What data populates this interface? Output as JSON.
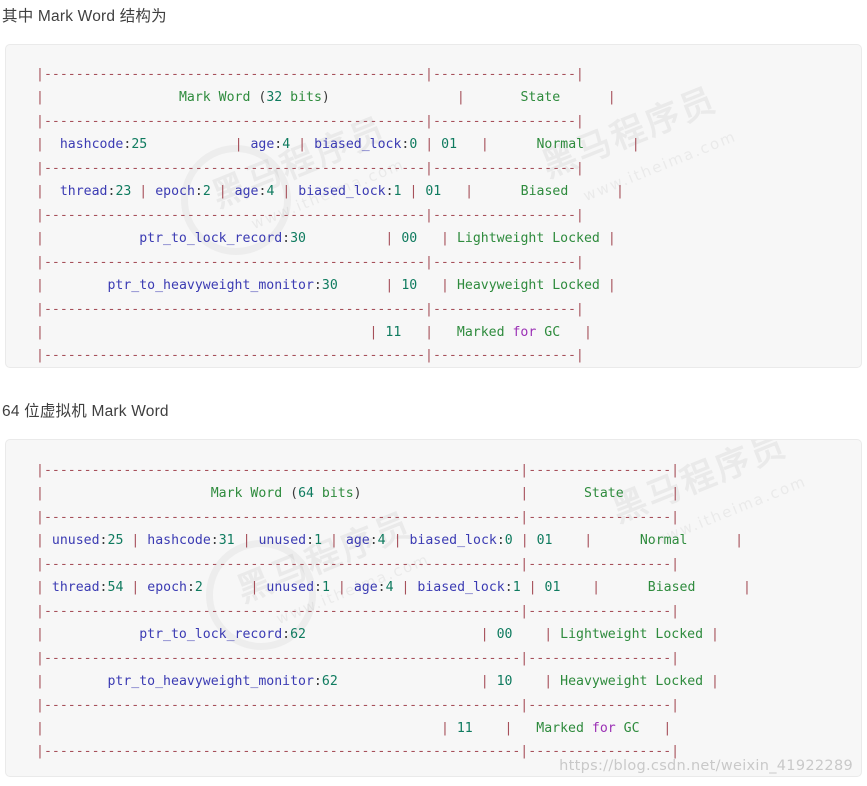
{
  "page": {
    "watermark_url": "https://blog.csdn.net/weixin_41922289",
    "watermark_brand": "黑马程序员",
    "watermark_site": "www.itheima.com",
    "background": "#ffffff",
    "card_background": "#f7f7f7",
    "card_border": "#eaeaea"
  },
  "colors": {
    "rule": "#a6505a",
    "identifier": "#3b3bb3",
    "number": "#0f7b5f",
    "word": "#2e8b3d",
    "keyword": "#9b30b5",
    "text": "#3b3b3b",
    "heading": "#3f3f3f"
  },
  "sections": [
    {
      "heading": "其中 Mark Word 结构为",
      "table": {
        "title_left": "Mark Word (32 bits)",
        "title_right": "State",
        "columns": [
          "Mark Word (32 bits)",
          "State"
        ],
        "bits": 32,
        "rows": [
          {
            "fields": [
              {
                "name": "hashcode",
                "size": 25
              },
              {
                "name": "age",
                "size": 4
              },
              {
                "name": "biased_lock",
                "size": 0
              }
            ],
            "tag": "01",
            "state": "Normal"
          },
          {
            "fields": [
              {
                "name": "thread",
                "size": 23
              },
              {
                "name": "epoch",
                "size": 2
              },
              {
                "name": "age",
                "size": 4
              },
              {
                "name": "biased_lock",
                "size": 1
              }
            ],
            "tag": "01",
            "state": "Biased"
          },
          {
            "fields": [
              {
                "name": "ptr_to_lock_record",
                "size": 30
              }
            ],
            "tag": "00",
            "state": "Lightweight Locked"
          },
          {
            "fields": [
              {
                "name": "ptr_to_heavyweight_monitor",
                "size": 30
              }
            ],
            "tag": "10",
            "state": "Heavyweight Locked"
          },
          {
            "fields": [],
            "tag": "11",
            "state": "Marked for GC"
          }
        ]
      },
      "ascii": [
        "|--------------------------------------------------------|------------------|",
        "|                  Mark Word (32 bits)                   |       State      |",
        "|--------------------------------------------------------|------------------|",
        "|  hashcode:25        | age:4 | biased_lock:0 | 01        |      Normal      |",
        "|--------------------------------------------------------|------------------|",
        "|  thread:23 | epoch:2 | age:4 | biased_lock:1 | 01       |      Biased      |",
        "|--------------------------------------------------------|------------------|",
        "|           ptr_to_lock_record:30            | 00         | Lightweight Locked |",
        "|--------------------------------------------------------|------------------|",
        "|        ptr_to_heavyweight_monitor:30       | 10         | Heavyweight Locked |",
        "|--------------------------------------------------------|------------------|",
        "|                                            | 11         |   Marked for GC  |",
        "|--------------------------------------------------------|------------------|"
      ]
    },
    {
      "heading": "64 位虚拟机 Mark Word",
      "table": {
        "title_left": "Mark Word (64 bits)",
        "title_right": "State",
        "columns": [
          "Mark Word (64 bits)",
          "State"
        ],
        "bits": 64,
        "rows": [
          {
            "fields": [
              {
                "name": "unused",
                "size": 25
              },
              {
                "name": "hashcode",
                "size": 31
              },
              {
                "name": "unused",
                "size": 1
              },
              {
                "name": "age",
                "size": 4
              },
              {
                "name": "biased_lock",
                "size": 0
              }
            ],
            "tag": "01",
            "state": "Normal"
          },
          {
            "fields": [
              {
                "name": "thread",
                "size": 54
              },
              {
                "name": "epoch",
                "size": 2
              },
              {
                "name": "unused",
                "size": 1
              },
              {
                "name": "age",
                "size": 4
              },
              {
                "name": "biased_lock",
                "size": 1
              }
            ],
            "tag": "01",
            "state": "Biased"
          },
          {
            "fields": [
              {
                "name": "ptr_to_lock_record",
                "size": 62
              }
            ],
            "tag": "00",
            "state": "Lightweight Locked"
          },
          {
            "fields": [
              {
                "name": "ptr_to_heavyweight_monitor",
                "size": 62
              }
            ],
            "tag": "10",
            "state": "Heavyweight Locked"
          },
          {
            "fields": [],
            "tag": "11",
            "state": "Marked for GC"
          }
        ]
      }
    }
  ]
}
